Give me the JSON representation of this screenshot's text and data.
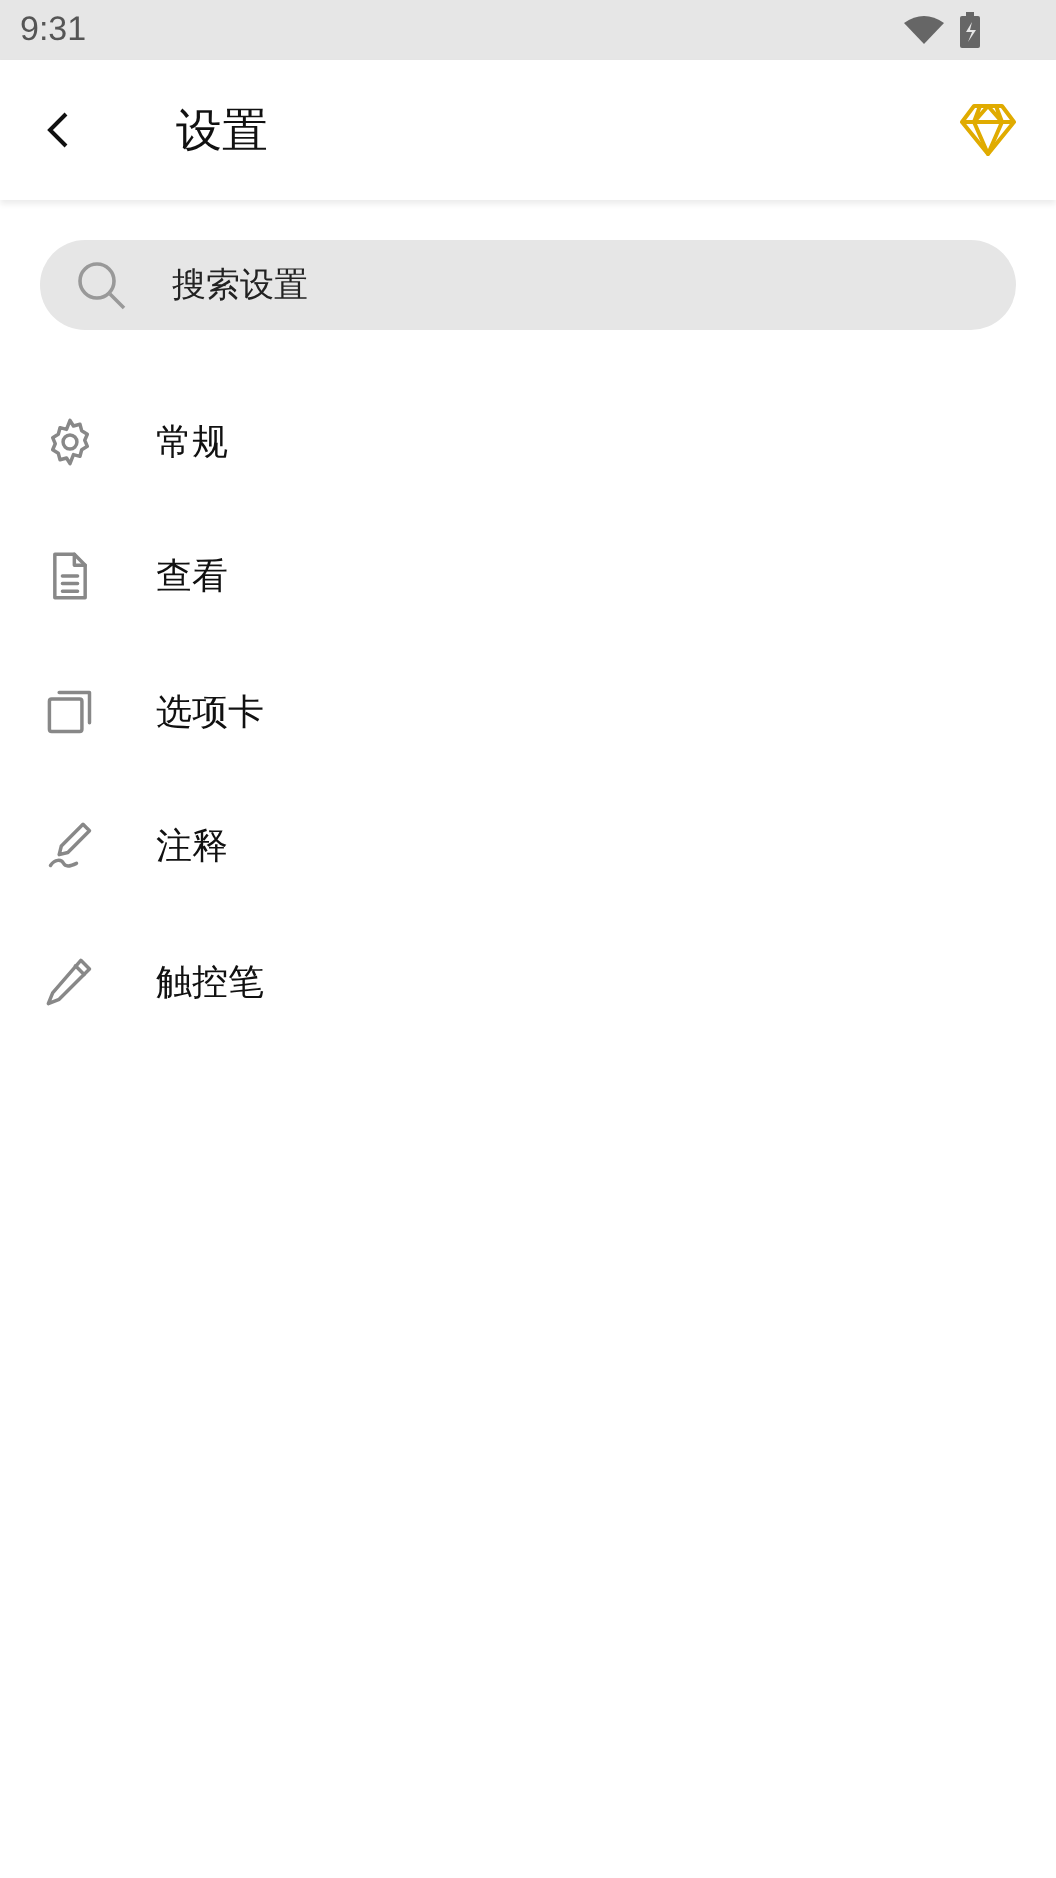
{
  "status_bar": {
    "time": "9:31"
  },
  "header": {
    "title": "设置"
  },
  "search": {
    "placeholder": "搜索设置"
  },
  "items": [
    {
      "kind": "general",
      "label": "常规"
    },
    {
      "kind": "view",
      "label": "查看"
    },
    {
      "kind": "tabs",
      "label": "选项卡"
    },
    {
      "kind": "annotation",
      "label": "注释"
    },
    {
      "kind": "stylus",
      "label": "触控笔"
    }
  ]
}
